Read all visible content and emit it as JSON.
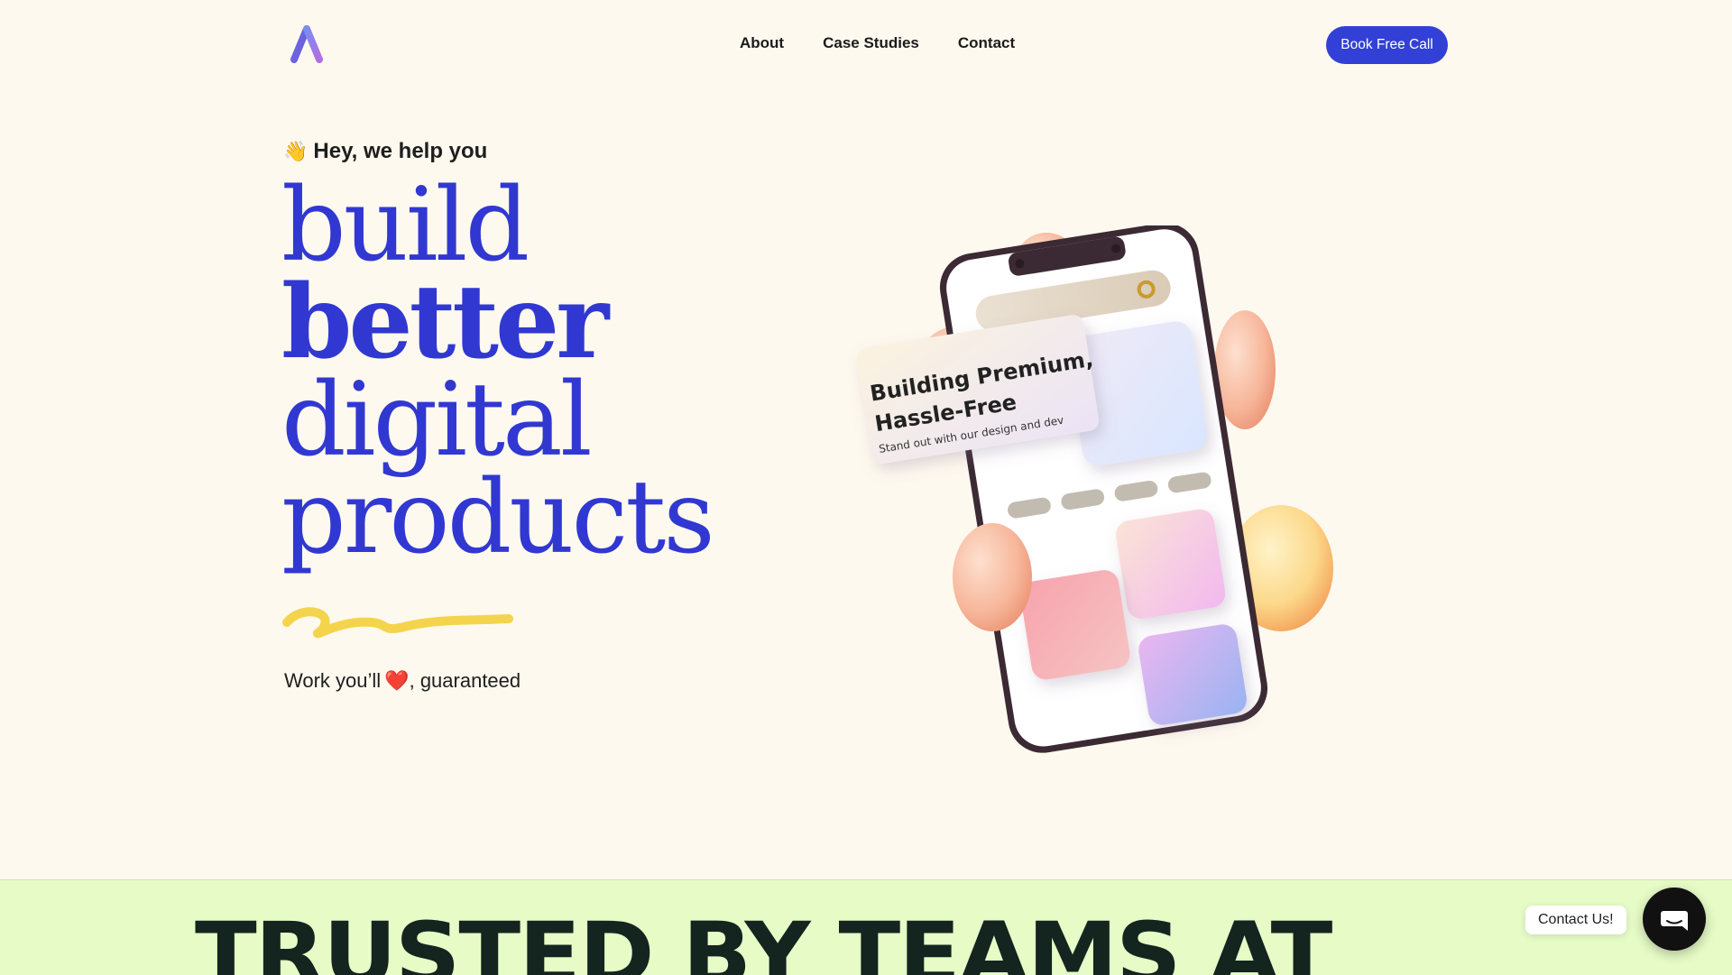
{
  "header": {
    "nav": [
      {
        "label": "About"
      },
      {
        "label": "Case Studies"
      },
      {
        "label": "Contact"
      }
    ],
    "cta_label": "Book Free Call"
  },
  "hero": {
    "greeting_emoji": "👋",
    "greeting": "Hey, we help you",
    "headline": [
      "build",
      "better",
      "digital",
      "products"
    ],
    "tagline_before": "Work you’ll",
    "tagline_emoji": "❤️",
    "tagline_after": ", guaranteed",
    "card_title_line1": "Building Premium,",
    "card_title_line2": "Hassle-Free",
    "card_subtitle": "Stand out with our design and dev"
  },
  "trusted": {
    "title": "TRUSTED BY TEAMS AT"
  },
  "chat": {
    "label": "Contact Us!"
  },
  "colors": {
    "background": "#fef9ef",
    "accent": "#3340d6",
    "headline": "#3138d2",
    "band": "#e6fbc6",
    "squiggle": "#f4d44d"
  },
  "icons": {
    "logo": "a-logo-icon",
    "chat": "chat-bubble-icon"
  }
}
